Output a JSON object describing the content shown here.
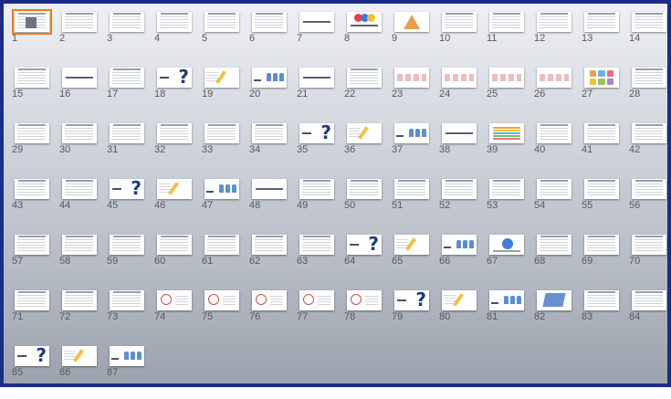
{
  "app": {
    "view": "Slide Sorter",
    "selected_slide": "1"
  },
  "slides": [
    {
      "n": "1",
      "t": "title"
    },
    {
      "n": "2",
      "t": "text"
    },
    {
      "n": "3",
      "t": "text"
    },
    {
      "n": "4",
      "t": "text"
    },
    {
      "n": "5",
      "t": "text"
    },
    {
      "n": "6",
      "t": "text"
    },
    {
      "n": "7",
      "t": "center"
    },
    {
      "n": "8",
      "t": "balloons"
    },
    {
      "n": "9",
      "t": "pyramid"
    },
    {
      "n": "10",
      "t": "text"
    },
    {
      "n": "11",
      "t": "text"
    },
    {
      "n": "12",
      "t": "text"
    },
    {
      "n": "13",
      "t": "text"
    },
    {
      "n": "14",
      "t": "text"
    },
    {
      "n": "15",
      "t": "text"
    },
    {
      "n": "16",
      "t": "center"
    },
    {
      "n": "17",
      "t": "text"
    },
    {
      "n": "18",
      "t": "question"
    },
    {
      "n": "19",
      "t": "pencil"
    },
    {
      "n": "20",
      "t": "people"
    },
    {
      "n": "21",
      "t": "center"
    },
    {
      "n": "22",
      "t": "text"
    },
    {
      "n": "23",
      "t": "flow"
    },
    {
      "n": "24",
      "t": "flow"
    },
    {
      "n": "25",
      "t": "flow"
    },
    {
      "n": "26",
      "t": "flow"
    },
    {
      "n": "27",
      "t": "tiles"
    },
    {
      "n": "28",
      "t": "text"
    },
    {
      "n": "29",
      "t": "text"
    },
    {
      "n": "30",
      "t": "text"
    },
    {
      "n": "31",
      "t": "text"
    },
    {
      "n": "32",
      "t": "text"
    },
    {
      "n": "33",
      "t": "text"
    },
    {
      "n": "34",
      "t": "text"
    },
    {
      "n": "35",
      "t": "question"
    },
    {
      "n": "36",
      "t": "pencil"
    },
    {
      "n": "37",
      "t": "people"
    },
    {
      "n": "38",
      "t": "center"
    },
    {
      "n": "39",
      "t": "bars"
    },
    {
      "n": "40",
      "t": "text"
    },
    {
      "n": "41",
      "t": "text"
    },
    {
      "n": "42",
      "t": "text"
    },
    {
      "n": "43",
      "t": "text"
    },
    {
      "n": "44",
      "t": "text"
    },
    {
      "n": "45",
      "t": "question"
    },
    {
      "n": "46",
      "t": "pencil"
    },
    {
      "n": "47",
      "t": "people"
    },
    {
      "n": "48",
      "t": "center"
    },
    {
      "n": "49",
      "t": "text"
    },
    {
      "n": "50",
      "t": "text"
    },
    {
      "n": "51",
      "t": "text"
    },
    {
      "n": "52",
      "t": "text"
    },
    {
      "n": "53",
      "t": "text"
    },
    {
      "n": "54",
      "t": "text"
    },
    {
      "n": "55",
      "t": "text"
    },
    {
      "n": "56",
      "t": "text"
    },
    {
      "n": "57",
      "t": "text"
    },
    {
      "n": "58",
      "t": "text"
    },
    {
      "n": "59",
      "t": "text"
    },
    {
      "n": "60",
      "t": "text"
    },
    {
      "n": "61",
      "t": "text"
    },
    {
      "n": "62",
      "t": "text"
    },
    {
      "n": "63",
      "t": "text"
    },
    {
      "n": "64",
      "t": "question"
    },
    {
      "n": "65",
      "t": "pencil"
    },
    {
      "n": "66",
      "t": "people"
    },
    {
      "n": "67",
      "t": "globe"
    },
    {
      "n": "68",
      "t": "text"
    },
    {
      "n": "69",
      "t": "text"
    },
    {
      "n": "70",
      "t": "text"
    },
    {
      "n": "71",
      "t": "text"
    },
    {
      "n": "72",
      "t": "text"
    },
    {
      "n": "73",
      "t": "text"
    },
    {
      "n": "74",
      "t": "circle"
    },
    {
      "n": "75",
      "t": "circle"
    },
    {
      "n": "76",
      "t": "circle"
    },
    {
      "n": "77",
      "t": "circle"
    },
    {
      "n": "78",
      "t": "circle"
    },
    {
      "n": "79",
      "t": "question"
    },
    {
      "n": "80",
      "t": "pencil"
    },
    {
      "n": "81",
      "t": "people"
    },
    {
      "n": "82",
      "t": "book"
    },
    {
      "n": "83",
      "t": "text"
    },
    {
      "n": "84",
      "t": "text"
    },
    {
      "n": "85",
      "t": "question"
    },
    {
      "n": "86",
      "t": "pencil"
    },
    {
      "n": "87",
      "t": "people"
    }
  ],
  "colors": {
    "border": "#1c2d86",
    "selection": "#f07a12",
    "number": "#54585f"
  }
}
